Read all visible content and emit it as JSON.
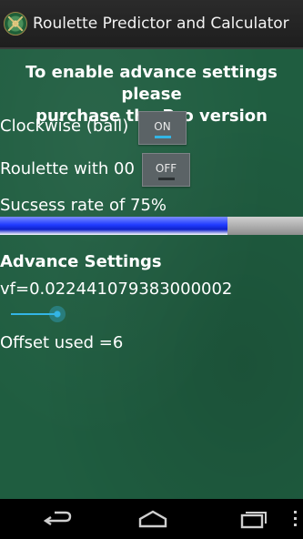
{
  "app": {
    "title": "Roulette Predictor and Calculator"
  },
  "notice": {
    "line1": "To enable advance settings please",
    "line2": "purchase the Pro version"
  },
  "settings": {
    "clockwise": {
      "label": "Clockwise (ball)",
      "state_text": "ON",
      "on": true
    },
    "double_zero": {
      "label": "Roulette with 00",
      "state_text": "OFF",
      "on": false
    }
  },
  "success": {
    "label": "Sucsess rate of 75%",
    "percent": 75
  },
  "advanced": {
    "heading": "Advance Settings",
    "vf_text": "vf=0.022441079383000002",
    "offset_text": "Offset used =6"
  },
  "navbar": {
    "icons": [
      "back-icon",
      "home-icon",
      "recents-icon"
    ]
  }
}
